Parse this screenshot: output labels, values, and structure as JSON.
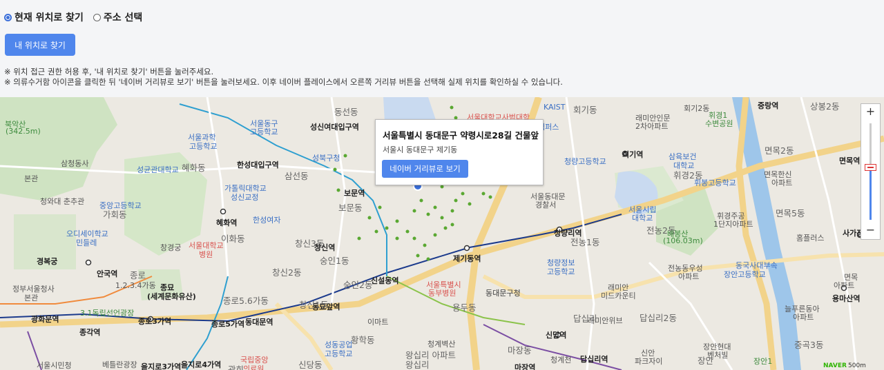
{
  "mode": {
    "options": [
      {
        "label": "현재 위치로 찾기",
        "checked": true
      },
      {
        "label": "주소 선택",
        "checked": false
      }
    ]
  },
  "locate_button": "내 위치로 찾기",
  "notes": [
    "※ 위치 접근 권한 허용 후, '내 위치로 찾기' 버튼을 눌러주세요.",
    "※ 의류수거함 아이콘을 클릭한 뒤 '네이버 거리뷰로 보기' 버튼을 눌러보세요. 이후 네이버 플레이스에서 오른쪽 거리뷰 버튼을 선택해 실제 위치를 확인하실 수 있습니다."
  ],
  "popup": {
    "title": "서울특별시 동대문구 약령시로28길 건물앞",
    "subtitle": "서울시 동대문구 제기동",
    "button": "네이버 거리뷰로 보기"
  },
  "map": {
    "zoom_in": "+",
    "zoom_out": "−",
    "scale": "500m",
    "provider": "NAVER",
    "labels": {
      "l01": "북악산",
      "l02": "(342.5m)",
      "l03": "삼청동사",
      "l04": "본관",
      "l05": "청와대 춘추관",
      "l06": "중앙고등학교",
      "l07": "가회동",
      "l08": "오디세이학교",
      "l09": "민들레",
      "l10": "경복궁",
      "l11": "안국역",
      "l12": "종로",
      "l13": "1.2.3.4가동",
      "l14": "종묘",
      "l15": "(세계문화유산)",
      "l16": "정부서울청사",
      "l17": "본관",
      "l18": "3.1독립선언광장",
      "l19": "광화문역",
      "l20": "종로3가역",
      "l21": "종각역",
      "l22": "서울시민청",
      "l23": "베틀란광장",
      "l24": "을지로3가역",
      "l25": "을지로4가역",
      "l26": "종로5.6가동",
      "l27": "종로5가역",
      "l28": "동대문역",
      "l29": "국립중앙",
      "l30": "의료원",
      "l31": "광희",
      "l32": "혜화동",
      "l33": "성균관대학교",
      "l34": "서울과학",
      "l35": "고등학교",
      "l36": "서울동구",
      "l37": "고등학교",
      "l38": "한성대입구역",
      "l39": "혜화역",
      "l40": "가톨릭대학교",
      "l41": "성신교정",
      "l42": "한성여자",
      "l43": "이화동",
      "l44": "서울대학교",
      "l45": "병원",
      "l46": "창경궁",
      "l47": "성북구청",
      "l48": "삼선동",
      "l49": "성신여대입구역",
      "l50": "보문역",
      "l51": "보문동",
      "l52": "창신3동",
      "l53": "창신역",
      "l54": "숭인1동",
      "l55": "창신2동",
      "l56": "숭인2동",
      "l57": "신설동역",
      "l58": "동묘앞역",
      "l59": "창신1동",
      "l60": "이마트",
      "l61": "황학동",
      "l62": "성동공업",
      "l63": "고등학교",
      "l64": "신당동",
      "l65": "동선동",
      "l66": "서울대학교사범대학",
      "l67": "KAIST",
      "l68": "캠퍼스",
      "l69": "회기동",
      "l70": "래미안인문",
      "l71": "2차아파트",
      "l72": "회기역",
      "l73": "청량고등학교",
      "l74": "서울동대문",
      "l75": "경찰서",
      "l76": "청량리역",
      "l77": "전농1동",
      "l78": "청량정보",
      "l79": "고등학교",
      "l80": "제기동역",
      "l81": "서울특별시",
      "l82": "동부병원",
      "l83": "동대문구청",
      "l84": "용두동",
      "l85": "청계벽산",
      "l86": "왕십리 아파트",
      "l87": "마장동",
      "l88": "신답역",
      "l89": "답십리역",
      "l90": "래미안위브",
      "l91": "답십리2동",
      "l92": "답십리",
      "l93": "청계천",
      "l94": "회기2동",
      "l95": "삼육보건",
      "l96": "대학교",
      "l97": "휘경2동",
      "l98": "휘봉고등학교",
      "l99": "서울시립",
      "l100": "대학교",
      "l101": "전농2동",
      "l102": "배봉산",
      "l103": "(106.03m)",
      "l104": "휘경주공",
      "l105": "1단지아파트",
      "l106": "전농동우성",
      "l107": "아파트",
      "l108": "동국사대부속",
      "l109": "장안고등학교",
      "l110": "래미안",
      "l111": "미드카운티",
      "l112": "휘경1",
      "l113": "수변공원",
      "l114": "중랑역",
      "l115": "상봉2동",
      "l116": "면목2동",
      "l117": "면목역",
      "l118": "면목한신",
      "l119": "아파트",
      "l120": "면목5동",
      "l121": "홈플러스",
      "l122": "사가정",
      "l123": "면목",
      "l124": "아파트",
      "l125": "용마산역",
      "l126": "늘푸른동아",
      "l127": "아파트",
      "l128": "중곡3동",
      "l129": "장안현대",
      "l130": "벤처빌",
      "l131": "장안1",
      "l132": "장안",
      "l133": "파크자이",
      "l134": "신안",
      "l135": "동대문구청",
      "l136": "마장역",
      "l137": "왕십리"
    }
  }
}
